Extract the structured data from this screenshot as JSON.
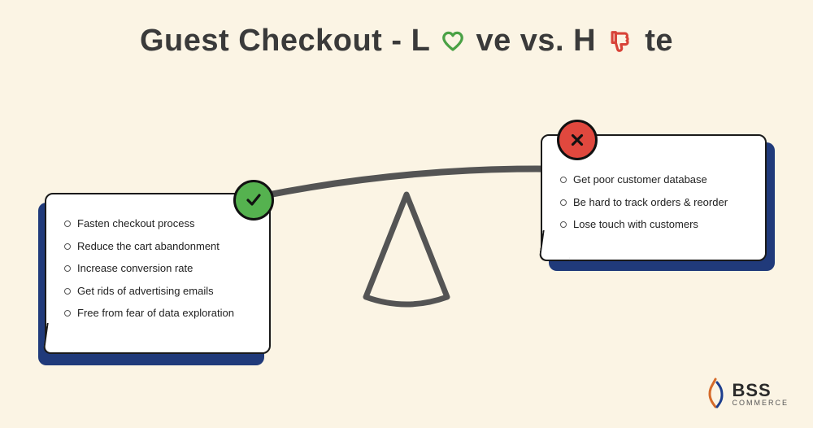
{
  "title": {
    "part1": "Guest Checkout - L",
    "part2": "ve vs. H",
    "part3": "te"
  },
  "love": {
    "items": [
      "Fasten checkout process",
      "Reduce the cart abandonment",
      "Increase conversion rate",
      "Get rids of advertising emails",
      "Free from fear of data exploration"
    ]
  },
  "hate": {
    "items": [
      "Get poor customer database",
      "Be hard to track orders & reorder",
      "Lose touch with customers"
    ]
  },
  "logo": {
    "main": "BSS",
    "sub": "COMMERCE"
  }
}
